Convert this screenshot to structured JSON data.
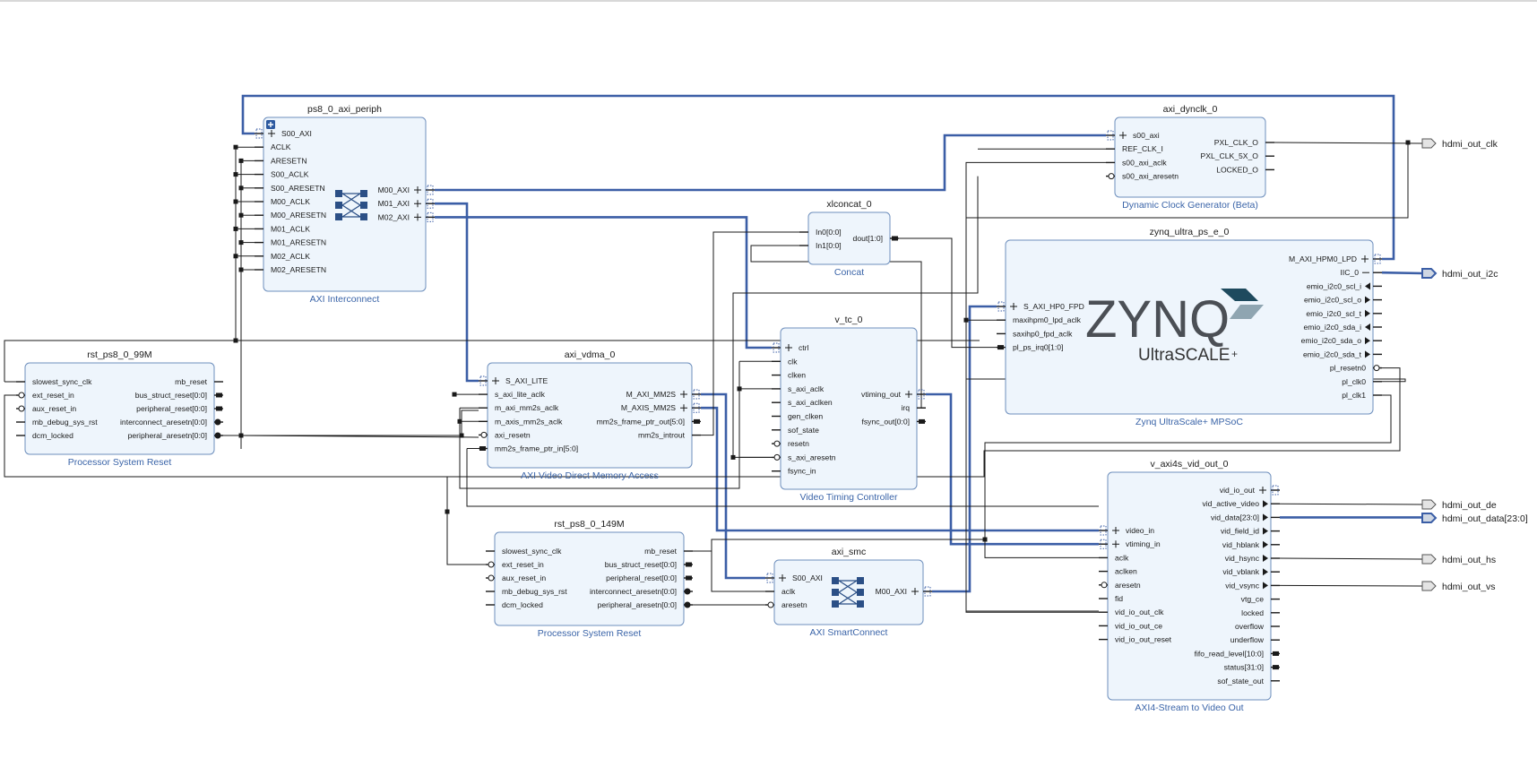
{
  "colors": {
    "block_fill": "#eef5fc",
    "block_border": "#6e8fbd",
    "bus": "#3b5ea6",
    "wire": "#1a1a1a",
    "subtitle": "#3a64a8",
    "port_fill": "#e4e4e4"
  },
  "blocks": [
    {
      "id": "ps8_0_axi_periph",
      "name": "ps8_0_axi_periph",
      "subtitle": "AXI Interconnect",
      "icon": "crossbar-icon",
      "collapse_icon": true,
      "left": [
        {
          "n": "S00_AXI",
          "t": "bus"
        },
        {
          "n": "ACLK"
        },
        {
          "n": "ARESETN"
        },
        {
          "n": "S00_ACLK"
        },
        {
          "n": "S00_ARESETN"
        },
        {
          "n": "M00_ACLK"
        },
        {
          "n": "M00_ARESETN"
        },
        {
          "n": "M01_ACLK"
        },
        {
          "n": "M01_ARESETN"
        },
        {
          "n": "M02_ACLK"
        },
        {
          "n": "M02_ARESETN"
        }
      ],
      "right": [
        {
          "n": "M00_AXI",
          "t": "bus"
        },
        {
          "n": "M01_AXI",
          "t": "bus"
        },
        {
          "n": "M02_AXI",
          "t": "bus"
        }
      ]
    },
    {
      "id": "axi_dynclk_0",
      "name": "axi_dynclk_0",
      "subtitle": "Dynamic Clock Generator (Beta)",
      "left": [
        {
          "n": "s00_axi",
          "t": "bus"
        },
        {
          "n": "REF_CLK_I"
        },
        {
          "n": "s00_axi_aclk"
        },
        {
          "n": "s00_axi_aresetn",
          "t": "neg"
        }
      ],
      "right": [
        {
          "n": "PXL_CLK_O"
        },
        {
          "n": "PXL_CLK_5X_O"
        },
        {
          "n": "LOCKED_O"
        }
      ]
    },
    {
      "id": "xlconcat_0",
      "name": "xlconcat_0",
      "subtitle": "Concat",
      "left": [
        {
          "n": "In0[0:0]"
        },
        {
          "n": "In1[0:0]"
        }
      ],
      "right": [
        {
          "n": "dout[1:0]",
          "t": "vec"
        }
      ]
    },
    {
      "id": "zynq_ultra_ps_e_0",
      "name": "zynq_ultra_ps_e_0",
      "subtitle": "Zynq UltraScale+ MPSoC",
      "logo": "ZYNQ",
      "logo_sub": "UltraSCALE",
      "logo_plus": "+",
      "left": [
        {
          "n": "S_AXI_HP0_FPD",
          "t": "bus"
        },
        {
          "n": "maxihpm0_lpd_aclk"
        },
        {
          "n": "saxihp0_fpd_aclk"
        },
        {
          "n": "pl_ps_irq0[1:0]",
          "t": "vec"
        }
      ],
      "right": [
        {
          "n": "M_AXI_HPM0_LPD",
          "t": "bus"
        },
        {
          "n": "IIC_0",
          "t": "iic"
        },
        {
          "n": "emio_i2c0_scl_i",
          "t": "in"
        },
        {
          "n": "emio_i2c0_scl_o",
          "t": "out"
        },
        {
          "n": "emio_i2c0_scl_t",
          "t": "out"
        },
        {
          "n": "emio_i2c0_sda_i",
          "t": "in"
        },
        {
          "n": "emio_i2c0_sda_o",
          "t": "out"
        },
        {
          "n": "emio_i2c0_sda_t",
          "t": "out"
        },
        {
          "n": "pl_resetn0",
          "t": "neg"
        },
        {
          "n": "pl_clk0"
        },
        {
          "n": "pl_clk1"
        }
      ]
    },
    {
      "id": "rst_ps8_0_99M",
      "name": "rst_ps8_0_99M",
      "subtitle": "Processor System Reset",
      "left": [
        {
          "n": "slowest_sync_clk"
        },
        {
          "n": "ext_reset_in",
          "t": "neg"
        },
        {
          "n": "aux_reset_in",
          "t": "neg"
        },
        {
          "n": "mb_debug_sys_rst"
        },
        {
          "n": "dcm_locked"
        }
      ],
      "right": [
        {
          "n": "mb_reset"
        },
        {
          "n": "bus_struct_reset[0:0]",
          "t": "vec"
        },
        {
          "n": "peripheral_reset[0:0]",
          "t": "vec"
        },
        {
          "n": "interconnect_aresetn[0:0]",
          "t": "vecneg"
        },
        {
          "n": "peripheral_aresetn[0:0]",
          "t": "vecneg"
        }
      ]
    },
    {
      "id": "axi_vdma_0",
      "name": "axi_vdma_0",
      "subtitle": "AXI Video Direct Memory Access",
      "left": [
        {
          "n": "S_AXI_LITE",
          "t": "bus"
        },
        {
          "n": "s_axi_lite_aclk"
        },
        {
          "n": "m_axi_mm2s_aclk"
        },
        {
          "n": "m_axis_mm2s_aclk"
        },
        {
          "n": "axi_resetn",
          "t": "neg"
        },
        {
          "n": "mm2s_frame_ptr_in[5:0]",
          "t": "vec"
        }
      ],
      "right": [
        {
          "n": "M_AXI_MM2S",
          "t": "bus"
        },
        {
          "n": "M_AXIS_MM2S",
          "t": "bus"
        },
        {
          "n": "mm2s_frame_ptr_out[5:0]",
          "t": "vec"
        },
        {
          "n": "mm2s_introut"
        }
      ]
    },
    {
      "id": "v_tc_0",
      "name": "v_tc_0",
      "subtitle": "Video Timing Controller",
      "left": [
        {
          "n": "ctrl",
          "t": "bus"
        },
        {
          "n": "clk"
        },
        {
          "n": "clken"
        },
        {
          "n": "s_axi_aclk"
        },
        {
          "n": "s_axi_aclken"
        },
        {
          "n": "gen_clken"
        },
        {
          "n": "sof_state"
        },
        {
          "n": "resetn",
          "t": "neg"
        },
        {
          "n": "s_axi_aresetn",
          "t": "neg"
        },
        {
          "n": "fsync_in"
        }
      ],
      "right": [
        {
          "n": "vtiming_out",
          "t": "bus"
        },
        {
          "n": "irq"
        },
        {
          "n": "fsync_out[0:0]",
          "t": "vec"
        }
      ]
    },
    {
      "id": "rst_ps8_0_149M",
      "name": "rst_ps8_0_149M",
      "subtitle": "Processor System Reset",
      "left": [
        {
          "n": "slowest_sync_clk"
        },
        {
          "n": "ext_reset_in",
          "t": "neg"
        },
        {
          "n": "aux_reset_in",
          "t": "neg"
        },
        {
          "n": "mb_debug_sys_rst"
        },
        {
          "n": "dcm_locked"
        }
      ],
      "right": [
        {
          "n": "mb_reset"
        },
        {
          "n": "bus_struct_reset[0:0]",
          "t": "vec"
        },
        {
          "n": "peripheral_reset[0:0]",
          "t": "vec"
        },
        {
          "n": "interconnect_aresetn[0:0]",
          "t": "vecneg"
        },
        {
          "n": "peripheral_aresetn[0:0]",
          "t": "vecneg"
        }
      ]
    },
    {
      "id": "axi_smc",
      "name": "axi_smc",
      "subtitle": "AXI SmartConnect",
      "icon": "crossbar-icon",
      "left": [
        {
          "n": "S00_AXI",
          "t": "bus"
        },
        {
          "n": "aclk"
        },
        {
          "n": "aresetn",
          "t": "neg"
        }
      ],
      "right": [
        {
          "n": "M00_AXI",
          "t": "bus"
        }
      ]
    },
    {
      "id": "v_axi4s_vid_out_0",
      "name": "v_axi4s_vid_out_0",
      "subtitle": "AXI4-Stream to Video Out",
      "left": [
        {
          "n": "video_in",
          "t": "bus"
        },
        {
          "n": "vtiming_in",
          "t": "bus"
        },
        {
          "n": "aclk"
        },
        {
          "n": "aclken"
        },
        {
          "n": "aresetn",
          "t": "neg"
        },
        {
          "n": "fid"
        },
        {
          "n": "vid_io_out_clk"
        },
        {
          "n": "vid_io_out_ce"
        },
        {
          "n": "vid_io_out_reset"
        }
      ],
      "right": [
        {
          "n": "vid_io_out",
          "t": "bus"
        },
        {
          "n": "vid_active_video",
          "t": "out"
        },
        {
          "n": "vid_data[23:0]",
          "t": "out"
        },
        {
          "n": "vid_field_id",
          "t": "out"
        },
        {
          "n": "vid_hblank",
          "t": "out"
        },
        {
          "n": "vid_hsync",
          "t": "out"
        },
        {
          "n": "vid_vblank",
          "t": "out"
        },
        {
          "n": "vid_vsync",
          "t": "out"
        },
        {
          "n": "vtg_ce"
        },
        {
          "n": "locked"
        },
        {
          "n": "overflow"
        },
        {
          "n": "underflow"
        },
        {
          "n": "fifo_read_level[10:0]",
          "t": "vec"
        },
        {
          "n": "status[31:0]",
          "t": "vec"
        },
        {
          "n": "sof_state_out"
        }
      ]
    }
  ],
  "external_ports": [
    {
      "id": "hdmi_out_clk",
      "label": "hdmi_out_clk"
    },
    {
      "id": "hdmi_out_i2c",
      "label": "hdmi_out_i2c",
      "bus": true
    },
    {
      "id": "hdmi_out_de",
      "label": "hdmi_out_de"
    },
    {
      "id": "hdmi_out_data",
      "label": "hdmi_out_data[23:0]",
      "bus": true
    },
    {
      "id": "hdmi_out_hs",
      "label": "hdmi_out_hs"
    },
    {
      "id": "hdmi_out_vs",
      "label": "hdmi_out_vs"
    }
  ]
}
